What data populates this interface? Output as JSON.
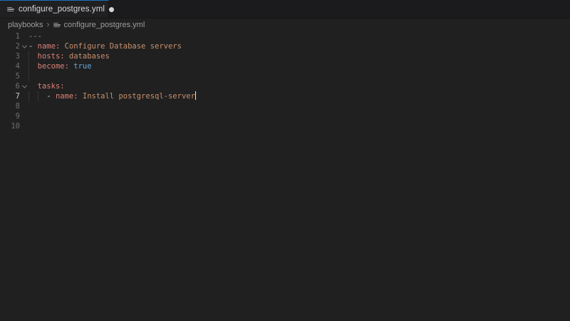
{
  "tab_bar": {
    "tabs": [
      {
        "label": "configure_postgres.yml",
        "modified": true,
        "icon": "yaml-file-icon"
      }
    ]
  },
  "breadcrumbs": {
    "separator": "›",
    "items": [
      {
        "label": "playbooks"
      },
      {
        "label": "configure_postgres.yml",
        "icon": "yaml-file-icon"
      }
    ]
  },
  "colors": {
    "accent_tab_border": "#1f6fbe",
    "editor_bg": "#202021",
    "tabbar_bg": "#1b1b1d",
    "key": "#de8277",
    "string": "#c8906b",
    "boolean": "#63a9de",
    "doc_marker": "#8e8e87"
  },
  "editor": {
    "language": "yaml",
    "cursor_line": 7,
    "lines": [
      {
        "num": "1",
        "tokens": [
          {
            "text": "---",
            "type": "doc"
          }
        ]
      },
      {
        "num": "2",
        "fold": true,
        "tokens": [
          {
            "text": "- ",
            "type": "plain"
          },
          {
            "text": "name:",
            "type": "key"
          },
          {
            "text": " Configure Database servers",
            "type": "str"
          }
        ]
      },
      {
        "num": "3",
        "guides": [
          0
        ],
        "tokens": [
          {
            "text": "  ",
            "type": "plain"
          },
          {
            "text": "hosts:",
            "type": "key"
          },
          {
            "text": " databases",
            "type": "str"
          }
        ]
      },
      {
        "num": "4",
        "guides": [
          0
        ],
        "tokens": [
          {
            "text": "  ",
            "type": "plain"
          },
          {
            "text": "become:",
            "type": "key"
          },
          {
            "text": " ",
            "type": "plain"
          },
          {
            "text": "true",
            "type": "bool"
          }
        ]
      },
      {
        "num": "5",
        "guides": [
          0
        ],
        "tokens": []
      },
      {
        "num": "6",
        "fold": true,
        "tokens": [
          {
            "text": "  ",
            "type": "plain"
          },
          {
            "text": "tasks:",
            "type": "key"
          }
        ]
      },
      {
        "num": "7",
        "active": true,
        "cursor": true,
        "guides": [
          0,
          2
        ],
        "tokens": [
          {
            "text": "    - ",
            "type": "plain"
          },
          {
            "text": "name:",
            "type": "key"
          },
          {
            "text": " Install postgresql-server",
            "type": "str"
          }
        ]
      },
      {
        "num": "8",
        "tokens": []
      },
      {
        "num": "9",
        "tokens": []
      },
      {
        "num": "10",
        "tokens": []
      }
    ]
  }
}
